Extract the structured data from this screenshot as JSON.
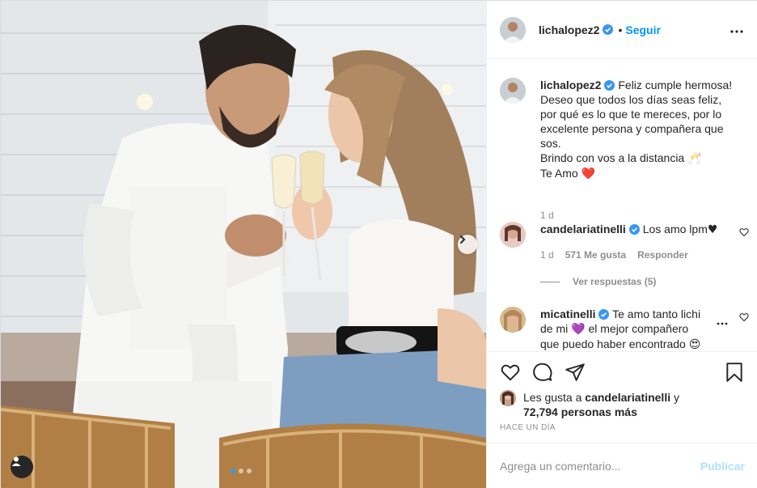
{
  "post": {
    "author": "lichalopez2",
    "follow_label": "Seguir",
    "separator": "•"
  },
  "caption": {
    "author": "lichalopez2",
    "line1": "Feliz cumple hermosa!",
    "line2": "Deseo que todos los días seas feliz,",
    "line3": "por qué es lo que te mereces, por lo",
    "line4": "excelente persona y compañera que",
    "line5": "sos.",
    "line6": "Brindo con vos a la distancia",
    "line6_emoji": "🥂",
    "line7": "Te Amo",
    "line7_emoji": "❤️",
    "time": "1 d"
  },
  "comments": [
    {
      "author": "candelariatinelli",
      "text": "Los amo lpm",
      "text_emoji": "♥",
      "time": "1 d",
      "likes": "571 Me gusta",
      "reply": "Responder",
      "view_replies": "Ver respuestas (5)"
    },
    {
      "author": "micatinelli",
      "line1": "Te amo tanto lichi",
      "line2a": "de mi",
      "line2_emoji": "💜",
      "line2b": "el mejor compañero",
      "line3": "que puedo haber encontrado",
      "line3_emoji": "😍"
    }
  ],
  "likes_summary": {
    "prefix": "Les gusta a",
    "user": "candelariatinelli",
    "conj": "y",
    "count": "72,794 personas más"
  },
  "timestamp": "HACE UN DÍA",
  "add_comment": {
    "placeholder": "Agrega un comentario...",
    "publish_label": "Publicar"
  },
  "icons": {
    "verified": "verified-badge-icon",
    "more": "more-options-icon",
    "like": "heart-icon",
    "comment": "comment-icon",
    "share": "share-icon",
    "save": "bookmark-icon",
    "next": "chevron-right-icon",
    "tag": "user-tag-icon"
  },
  "colors": {
    "accent": "#0095f6",
    "verified": "#3897f0",
    "muted": "#8e8e8e",
    "publish_disabled": "#b2dffc",
    "carousel_active": "#2d9cf0"
  },
  "carousel": {
    "total": 3,
    "active": 1
  }
}
